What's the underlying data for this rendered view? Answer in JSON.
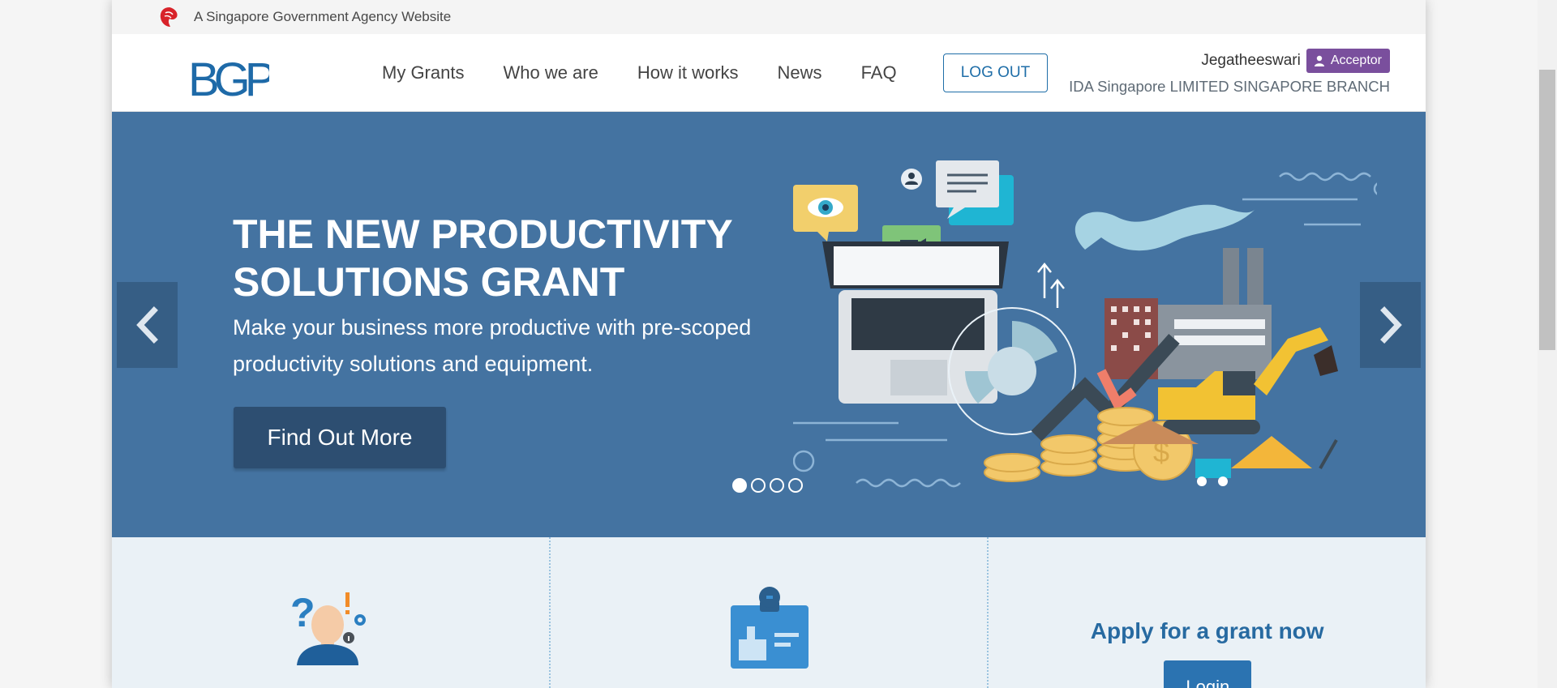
{
  "masthead": {
    "text": "A Singapore Government Agency Website",
    "icon": "lion-head-icon"
  },
  "logo_text": "BGP",
  "nav": {
    "items": [
      {
        "label": "My Grants"
      },
      {
        "label": "Who we are"
      },
      {
        "label": "How it works"
      },
      {
        "label": "News"
      },
      {
        "label": "FAQ"
      }
    ],
    "logout_label": "LOG OUT"
  },
  "user": {
    "name": "Jegatheeswari",
    "role": "Acceptor",
    "organisation": "IDA Singapore LIMITED SINGAPORE BRANCH"
  },
  "hero": {
    "title": "THE NEW PRODUCTIVITY SOLUTIONS GRANT",
    "subtitle": "Make your business more productive with pre-scoped productivity solutions and equipment.",
    "button_label": "Find Out More",
    "slide_count": 4,
    "active_slide": 1
  },
  "features": {
    "apply_title": "Apply for a grant now",
    "login_label": "Login"
  },
  "colors": {
    "hero_bg": "#4473a1",
    "brand_blue": "#1f6ea8",
    "badge_purple": "#7a4f9d",
    "feature_bg": "#eaf1f6"
  }
}
